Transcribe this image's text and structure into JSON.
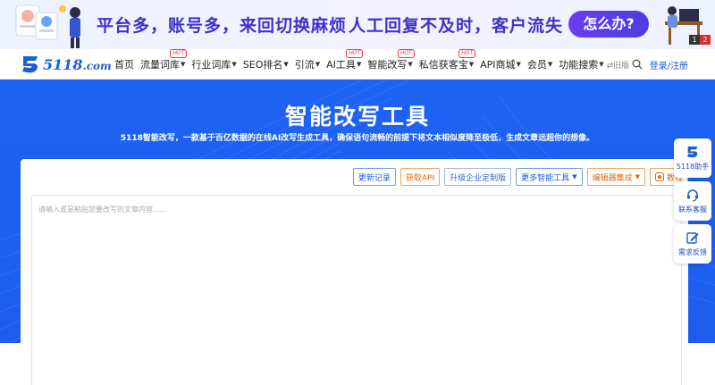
{
  "ad": {
    "text_left": "平台多，账号多，来回切换麻烦",
    "text_right": "人工回复不及时，客户流失",
    "cta": "怎么办?",
    "pager": [
      "1",
      "2"
    ]
  },
  "nav": {
    "logo_main": "5118",
    "logo_suffix": ".com",
    "items": [
      {
        "label": "首页",
        "caret": false,
        "hot": false
      },
      {
        "label": "流量词库",
        "caret": true,
        "hot": true
      },
      {
        "label": "行业词库",
        "caret": true,
        "hot": false
      },
      {
        "label": "SEO排名",
        "caret": true,
        "hot": false
      },
      {
        "label": "引流",
        "caret": true,
        "hot": false
      },
      {
        "label": "AI工具",
        "caret": true,
        "hot": true
      },
      {
        "label": "智能改写",
        "caret": true,
        "hot": true
      },
      {
        "label": "私信获客宝",
        "caret": true,
        "hot": true
      },
      {
        "label": "API商城",
        "caret": true,
        "hot": false
      },
      {
        "label": "会员",
        "caret": true,
        "hot": false
      },
      {
        "label": "功能搜索",
        "caret": true,
        "hot": false
      }
    ],
    "hot_label": "HOT",
    "old_version": "⇄旧版",
    "login": "登录/注册"
  },
  "hero": {
    "title": "智能改写工具",
    "subtitle": "5118智能改写，一款基于百亿数据的在线AI改写生成工具，确保语句流畅的前提下将文本相似度降至极低，生成文章远超你的想像。"
  },
  "toolbar": {
    "history": "更新记录",
    "api": "获取API",
    "enterprise": "升级企业定制版",
    "more_tools": "更多智能工具",
    "editor_integration": "编辑器集成",
    "tutorial": "教程"
  },
  "editor": {
    "placeholder": "请输入或是粘贴您要改写的文章内容......"
  },
  "side": {
    "assistant": "5118助手",
    "service": "联系客服",
    "feedback": "需求反馈"
  },
  "colors": {
    "brand_blue": "#1d63f2",
    "orange": "#e56a12",
    "hot_red": "#e4393c"
  }
}
